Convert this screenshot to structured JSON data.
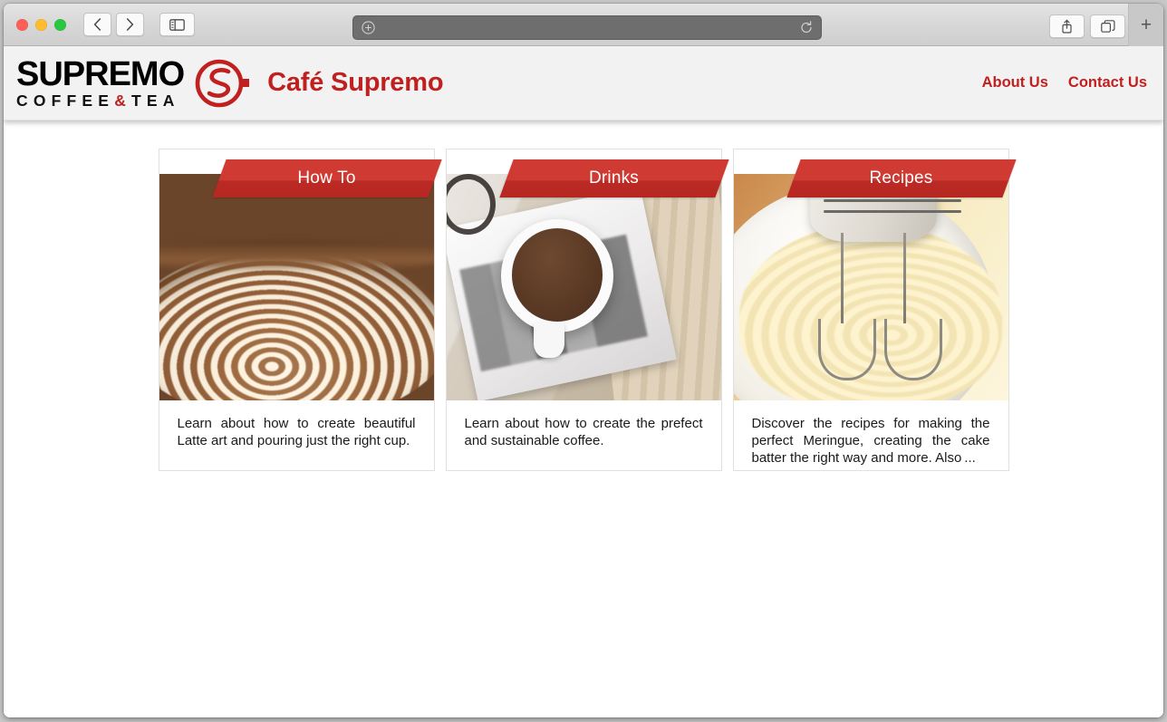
{
  "browser": {
    "traffic_lights": [
      "close",
      "minimize",
      "maximize"
    ],
    "back_label": "‹",
    "forward_label": "›",
    "sidebar_icon": "sidebar-icon",
    "address": {
      "value": "",
      "placeholder": "",
      "left_icon": "add-bookmark-icon",
      "reload_icon": "reload-icon"
    },
    "share_icon": "share-icon",
    "tabs_icon": "tab-overview-icon",
    "new_tab_label": "+"
  },
  "site": {
    "logo": {
      "word_primary": "SUPREMO",
      "word_secondary_left": "COFFEE",
      "word_secondary_amp": "&",
      "word_secondary_right": "TEA",
      "emblem": "supremo-s-emblem"
    },
    "title": "Café Supremo",
    "nav": [
      {
        "label": "About Us"
      },
      {
        "label": "Contact Us"
      }
    ],
    "colors": {
      "brand_red": "#c0201f",
      "ribbon_red": "#cf3a33",
      "ribbon_red_dark": "#b72722",
      "header_bg": "#f2f2f2",
      "card_border": "#e0e0e0"
    }
  },
  "cards": [
    {
      "ribbon": "How To",
      "image": "latte-art-photo",
      "text": "Learn about how to create beautiful Latte art and pouring just the right cup."
    },
    {
      "ribbon": "Drinks",
      "image": "coffee-mug-on-magazine-photo",
      "text": "Learn about how to create the prefect and sustainable coffee."
    },
    {
      "ribbon": "Recipes",
      "image": "hand-mixer-whipping-cream-photo",
      "text": "Discover the recipes for making the perfect Meringue, creating the cake batter the right way and more. Also ..."
    }
  ]
}
